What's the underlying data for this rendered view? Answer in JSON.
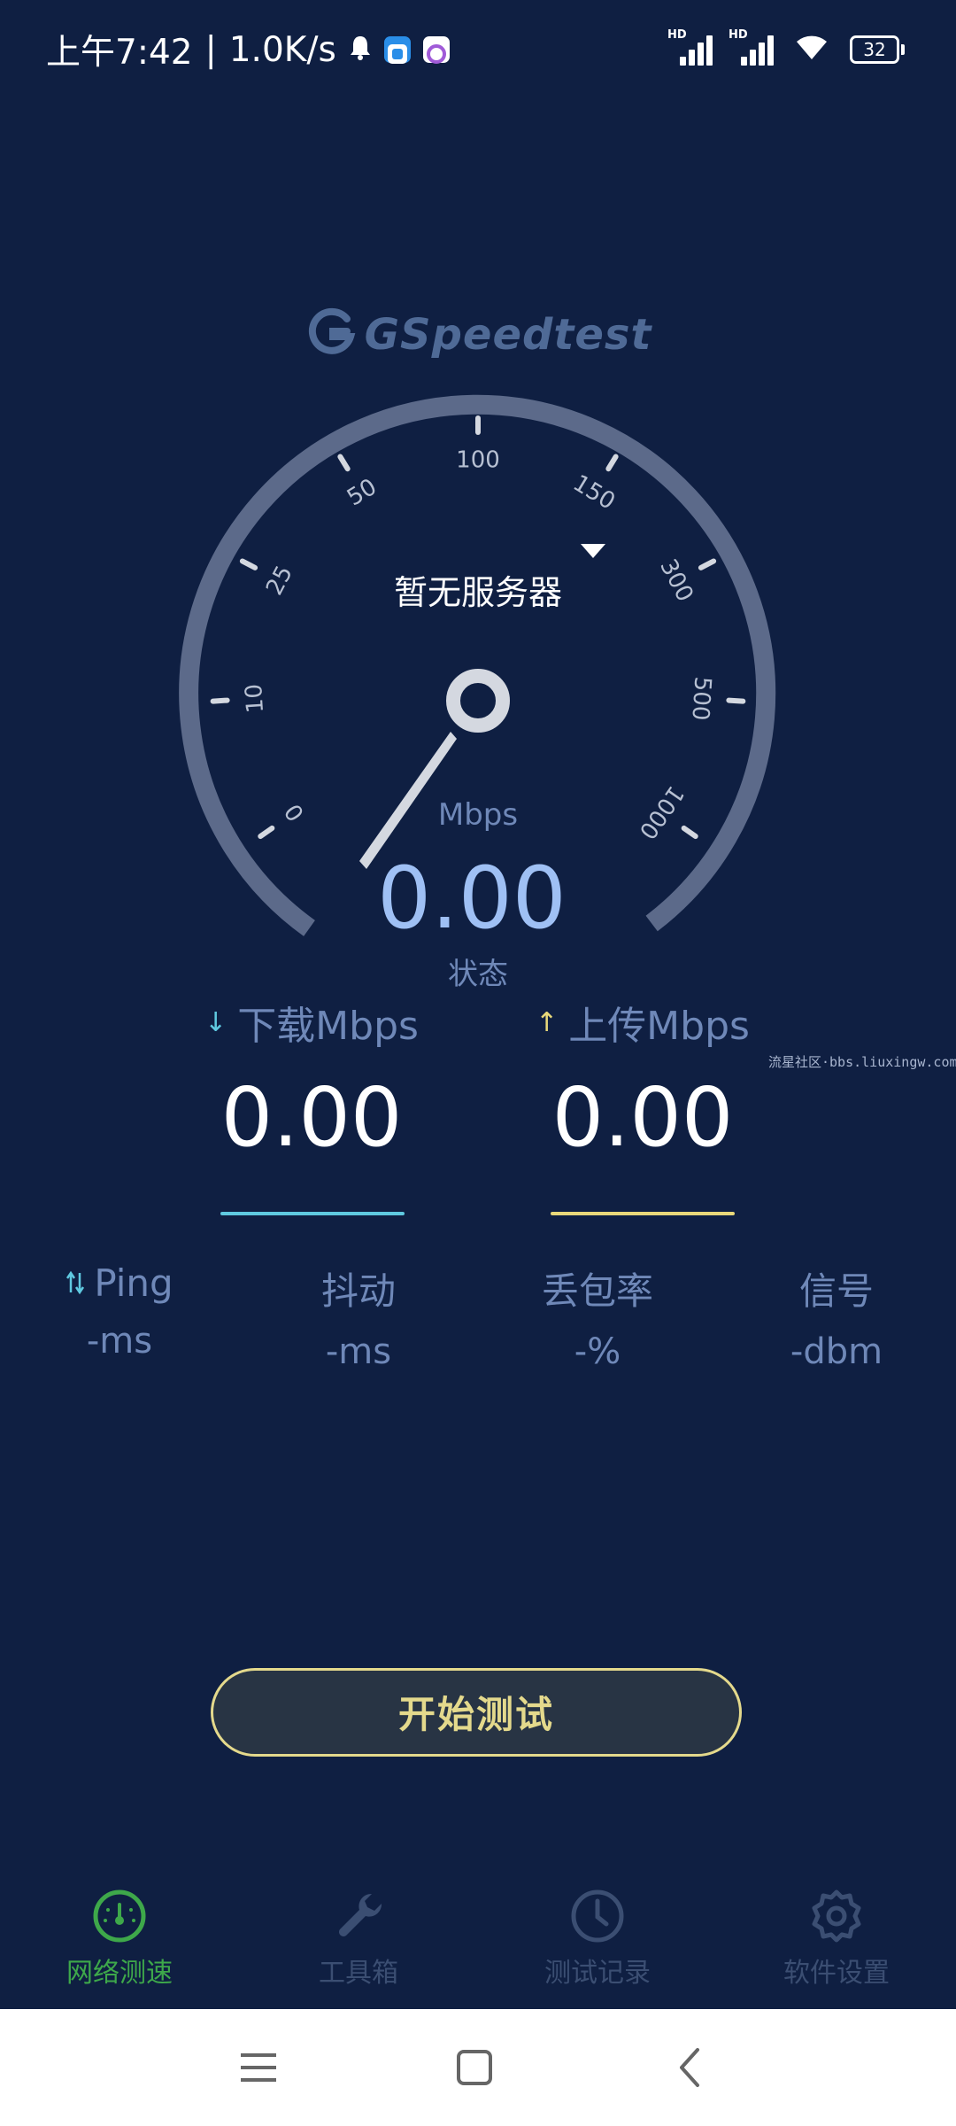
{
  "status_bar": {
    "time": "上午7:42",
    "speed": "1.0K/s",
    "battery": "32"
  },
  "app": {
    "logo": "GSpeedtest"
  },
  "gauge": {
    "server": "暂无服务器",
    "unit": "Mbps",
    "value": "0.00",
    "state": "状态",
    "ticks": [
      "0",
      "10",
      "25",
      "50",
      "100",
      "150",
      "300",
      "500",
      "1000"
    ]
  },
  "download": {
    "label": "下载Mbps",
    "value": "0.00",
    "arrow": "↓"
  },
  "upload": {
    "label": "上传Mbps",
    "value": "0.00",
    "arrow": "↑"
  },
  "watermark": "流星社区·bbs.liuxingw.com",
  "stats": [
    {
      "label": "Ping",
      "value": "-ms"
    },
    {
      "label": "抖动",
      "value": "-ms"
    },
    {
      "label": "丢包率",
      "value": "-%"
    },
    {
      "label": "信号",
      "value": "-dbm"
    }
  ],
  "start_button": "开始测试",
  "nav": [
    {
      "label": "网络测速",
      "icon": "speedometer-icon",
      "active": true
    },
    {
      "label": "工具箱",
      "icon": "wrench-icon",
      "active": false
    },
    {
      "label": "测试记录",
      "icon": "clock-icon",
      "active": false
    },
    {
      "label": "软件设置",
      "icon": "gear-icon",
      "active": false
    }
  ],
  "colors": {
    "background": "#0f1f42",
    "gauge_ring": "#5c6a8a",
    "accent_blue": "#9fc0f4",
    "download_line": "#5fc9e0",
    "upload_line": "#e8d87a",
    "button_border": "#e4d98c",
    "nav_active": "#3ea84a",
    "nav_inactive": "#3b4e72"
  }
}
